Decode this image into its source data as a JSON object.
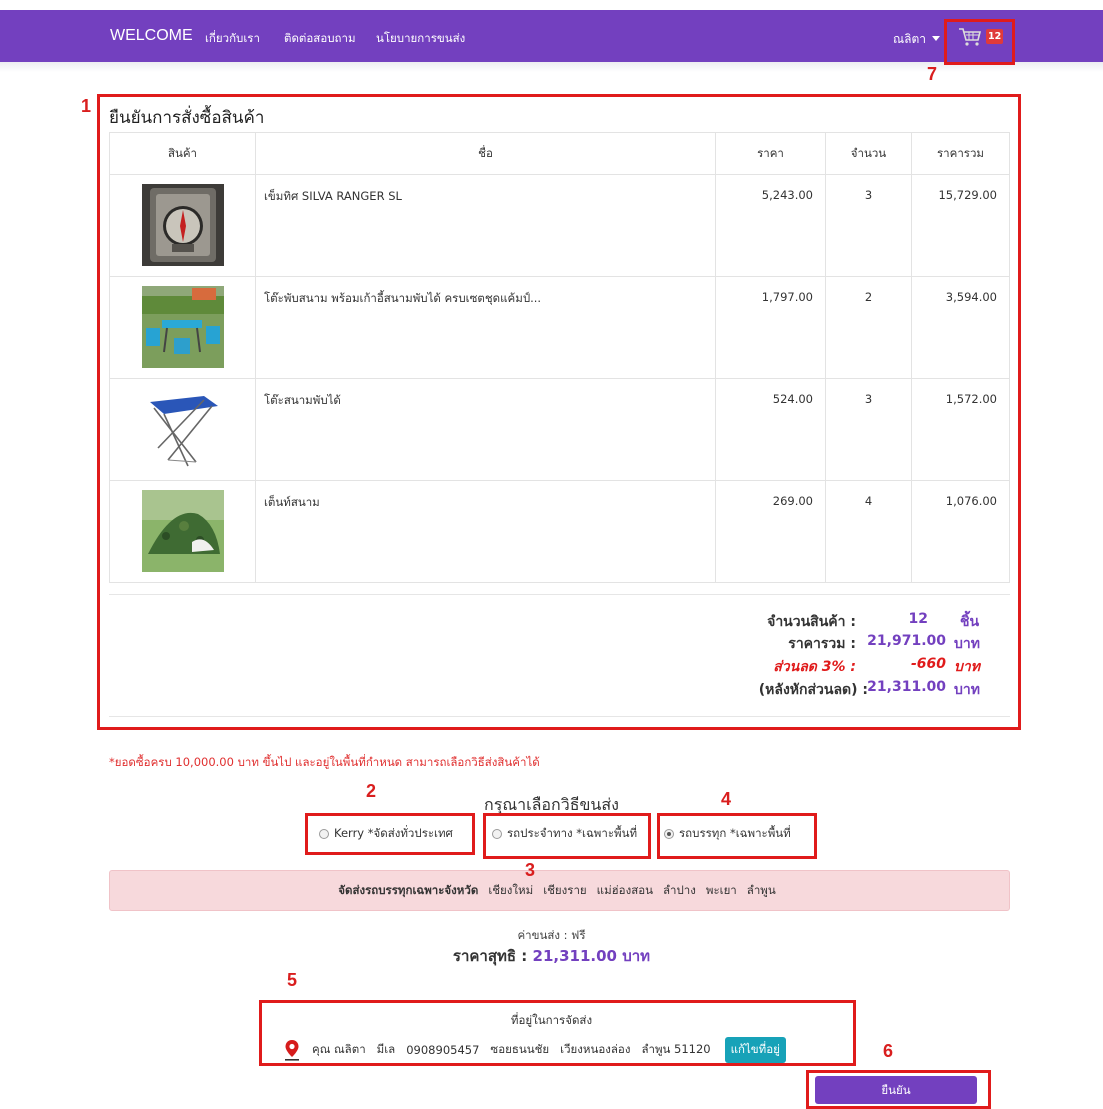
{
  "navbar": {
    "brand": "WELCOME",
    "links": [
      "เกี่ยวกับเรา",
      "ติดต่อสอบถาม",
      "นโยบายการขนส่ง"
    ],
    "user": "ณลิตา",
    "cart_count": "12"
  },
  "order": {
    "title": "ยืนยันการสั่งซื้อสินค้า",
    "headers": [
      "สินค้า",
      "ชื่อ",
      "ราคา",
      "จำนวน",
      "ราคารวม"
    ],
    "items": [
      {
        "name": "เข็มทิศ SILVA RANGER SL",
        "price": "5,243.00",
        "qty": "3",
        "total": "15,729.00",
        "image": "compass-image"
      },
      {
        "name": "โต๊ะพับสนาม พร้อมเก้าอี้สนามพับได้ ครบเซตชุดแค้มป์...",
        "price": "1,797.00",
        "qty": "2",
        "total": "3,594.00",
        "image": "camping-table-set-image"
      },
      {
        "name": "โต๊ะสนามพับได้",
        "price": "524.00",
        "qty": "3",
        "total": "1,572.00",
        "image": "folding-table-image"
      },
      {
        "name": "เต็นท์สนาม",
        "price": "269.00",
        "qty": "4",
        "total": "1,076.00",
        "image": "tent-image"
      }
    ],
    "summary": {
      "qty_label": "จำนวนสินค้า :",
      "qty_value": "12",
      "qty_unit": "ชิ้น",
      "total_label": "ราคารวม :",
      "total_value": "21,971.00",
      "total_unit": "บาท",
      "discount_label": "ส่วนลด 3% :",
      "discount_value": "-660",
      "discount_unit": "บาท",
      "after_label": "(หลังหักส่วนลด) :",
      "after_value": "21,311.00",
      "after_unit": "บาท"
    }
  },
  "promo_note": "*ยอดซื้อครบ 10,000.00 บาท ขึ้นไป และอยู่ในพื้นที่กำหนด สามารถเลือกวิธีส่งสินค้าได้",
  "shipping": {
    "title": "กรุณาเลือกวิธีขนส่ง",
    "options": [
      {
        "label": "Kerry *จัดส่งทั่วประเทศ",
        "selected": false
      },
      {
        "label": "รถประจำทาง *เฉพาะพื้นที่",
        "selected": false
      },
      {
        "label": "รถบรรทุก *เฉพาะพื้นที่",
        "selected": true
      }
    ],
    "alert_label": "จัดส่งรถบรรทุกเฉพาะจังหวัด",
    "provinces": [
      "เชียงใหม่",
      "เชียงราย",
      "แม่ฮ่องสอน",
      "ลำปาง",
      "พะเยา",
      "ลำพูน"
    ],
    "fee_text": "ค่าขนส่ง : ฟรี",
    "net_label": "ราคาสุทธิ :",
    "net_value": "21,311.00",
    "net_unit": "บาท"
  },
  "address": {
    "title": "ที่อยู่ในการจัดส่ง",
    "name": "คุณ ณลิตา",
    "surname": "มีเล",
    "phone": "0908905457",
    "street": "ซอยธนนชัย",
    "district": "เวียงหนองล่อง",
    "province_zip": "ลำพูน 51120",
    "edit_label": "แก้ไขที่อยู่"
  },
  "confirm_label": "ยืนยัน",
  "annotations": [
    "1",
    "2",
    "3",
    "4",
    "5",
    "6",
    "7"
  ],
  "colors": {
    "primary": "#7340bf",
    "annotation": "#e01b1b",
    "alert_bg": "#f7d9dc",
    "edit_button": "#17a2b8"
  }
}
